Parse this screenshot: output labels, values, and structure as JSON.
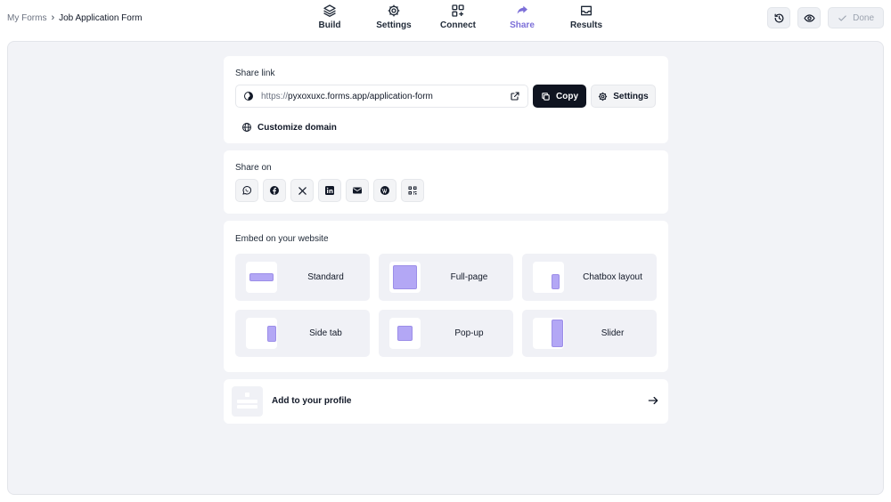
{
  "breadcrumb": {
    "root": "My Forms",
    "separator": "›",
    "current": "Job Application Form"
  },
  "nav": {
    "tabs": [
      {
        "label": "Build",
        "icon": "layers-icon"
      },
      {
        "label": "Settings",
        "icon": "gear-icon"
      },
      {
        "label": "Connect",
        "icon": "grid-plus-icon"
      },
      {
        "label": "Share",
        "icon": "share-arrow-icon",
        "active": true
      },
      {
        "label": "Results",
        "icon": "inbox-icon"
      }
    ]
  },
  "toolbar": {
    "history_icon": "history-icon",
    "preview_icon": "eye-icon",
    "done_label": "Done"
  },
  "share_link": {
    "title": "Share link",
    "url_prefix": "https://",
    "url_host": "pyxoxuxc.forms.app/application-form",
    "copy_label": "Copy",
    "settings_label": "Settings",
    "customize_label": "Customize domain"
  },
  "share_on": {
    "title": "Share on",
    "networks": [
      "whatsapp-icon",
      "facebook-icon",
      "x-icon",
      "linkedin-icon",
      "email-icon",
      "wordpress-icon",
      "qr-code-icon"
    ]
  },
  "embed": {
    "title": "Embed on your website",
    "options": [
      "Standard",
      "Full-page",
      "Chatbox layout",
      "Side tab",
      "Pop-up",
      "Slider"
    ]
  },
  "profile": {
    "label": "Add to your profile"
  },
  "colors": {
    "accent": "#7c6fd8",
    "primary_button": "#0f1420",
    "embed_shape": "#b3a7f5",
    "canvas": "#f2f3f7"
  }
}
